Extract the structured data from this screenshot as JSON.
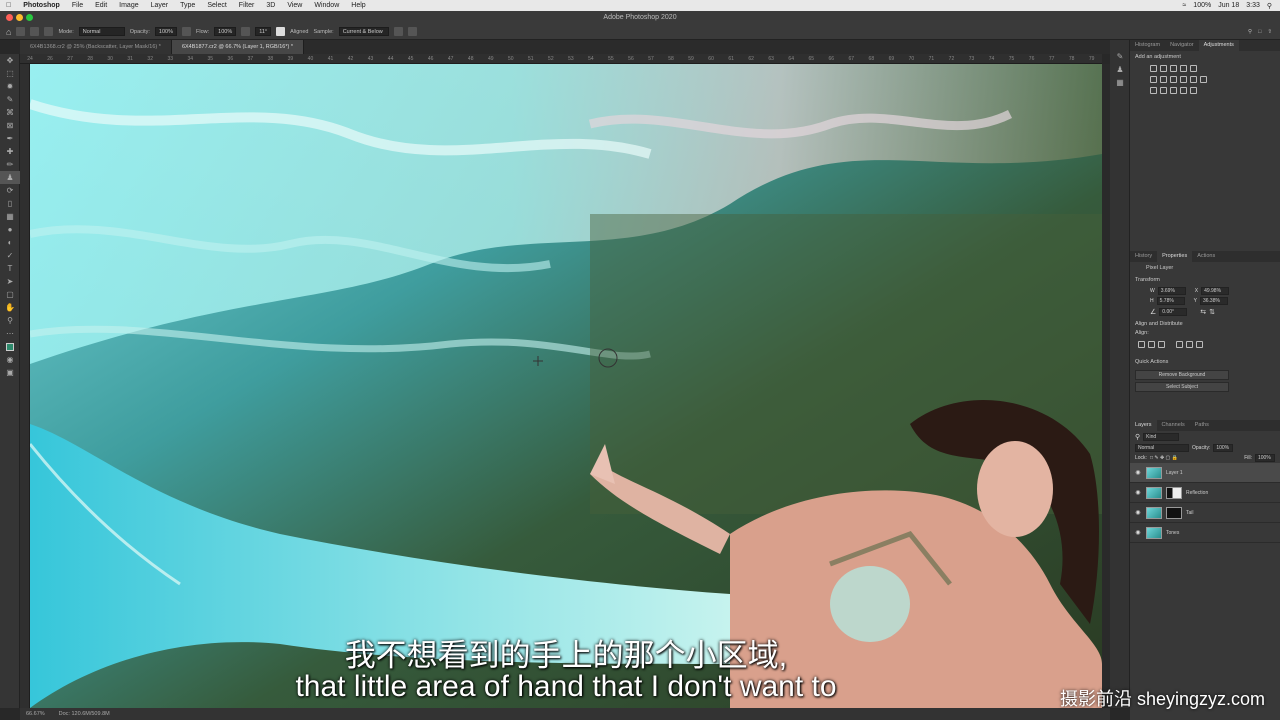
{
  "menubar": {
    "app": "Photoshop",
    "items": [
      "File",
      "Edit",
      "Image",
      "Layer",
      "Type",
      "Select",
      "Filter",
      "3D",
      "View",
      "Window",
      "Help"
    ],
    "battery": "100%",
    "date": "Jun 18",
    "time": "3:33"
  },
  "window": {
    "title": "Adobe Photoshop 2020"
  },
  "options": {
    "mode_label": "Mode:",
    "mode_value": "Normal",
    "opacity_label": "Opacity:",
    "opacity_value": "100%",
    "flow_label": "Flow:",
    "flow_value": "100%",
    "angle_value": "11°",
    "aligned_label": "Aligned",
    "sample_label": "Sample:",
    "sample_value": "Current & Below"
  },
  "tabs": [
    {
      "label": "6X4B1368.cr2 @ 25% (Backscatter, Layer Mask/16) *"
    },
    {
      "label": "6X4B1877.cr2 @ 66.7% (Layer 1, RGB/16*) *"
    }
  ],
  "ruler": {
    "ticks": [
      "24",
      "26",
      "27",
      "28",
      "30",
      "31",
      "32",
      "33",
      "34",
      "35",
      "36",
      "37",
      "38",
      "39",
      "40",
      "41",
      "42",
      "43",
      "44",
      "45",
      "46",
      "47",
      "48",
      "49",
      "50",
      "51",
      "52",
      "53",
      "54",
      "55",
      "56",
      "57",
      "58",
      "59",
      "60",
      "61",
      "62",
      "63",
      "64",
      "65",
      "66",
      "67",
      "68",
      "69",
      "70",
      "71",
      "72",
      "73",
      "74",
      "75",
      "76",
      "77",
      "78",
      "79"
    ]
  },
  "status": {
    "zoom": "66.67%",
    "doc": "Doc: 120.6M/509.8M"
  },
  "adjustments_panel": {
    "tabs": [
      "Histogram",
      "Navigator",
      "Adjustments"
    ],
    "hint": "Add an adjustment"
  },
  "properties_panel": {
    "tabs": [
      "History",
      "Properties",
      "Actions"
    ],
    "kind": "Pixel Layer",
    "transform_title": "Transform",
    "w_label": "W",
    "w_value": "3.69%",
    "x_label": "X",
    "x_value": "49.98%",
    "h_label": "H",
    "h_value": "5.78%",
    "y_label": "Y",
    "y_value": "36.38%",
    "angle_value": "0.00°",
    "align_title": "Align and Distribute",
    "align_label": "Align:",
    "quick_title": "Quick Actions",
    "remove_bg": "Remove Background",
    "select_subject": "Select Subject"
  },
  "layers_panel": {
    "tabs": [
      "Layers",
      "Channels",
      "Paths"
    ],
    "filter_label": "Kind",
    "blend_mode": "Normal",
    "opacity_label": "Opacity:",
    "opacity_value": "100%",
    "lock_label": "Lock:",
    "fill_label": "Fill:",
    "fill_value": "100%",
    "layers": [
      {
        "name": "Layer 1"
      },
      {
        "name": "Reflection"
      },
      {
        "name": "Tail"
      },
      {
        "name": "Tones"
      }
    ]
  },
  "subtitles": {
    "cn": "我不想看到的手上的那个小区域,",
    "en": "that little area of hand that I don't want to"
  },
  "watermark": "摄影前沿 sheyingzyz.com"
}
